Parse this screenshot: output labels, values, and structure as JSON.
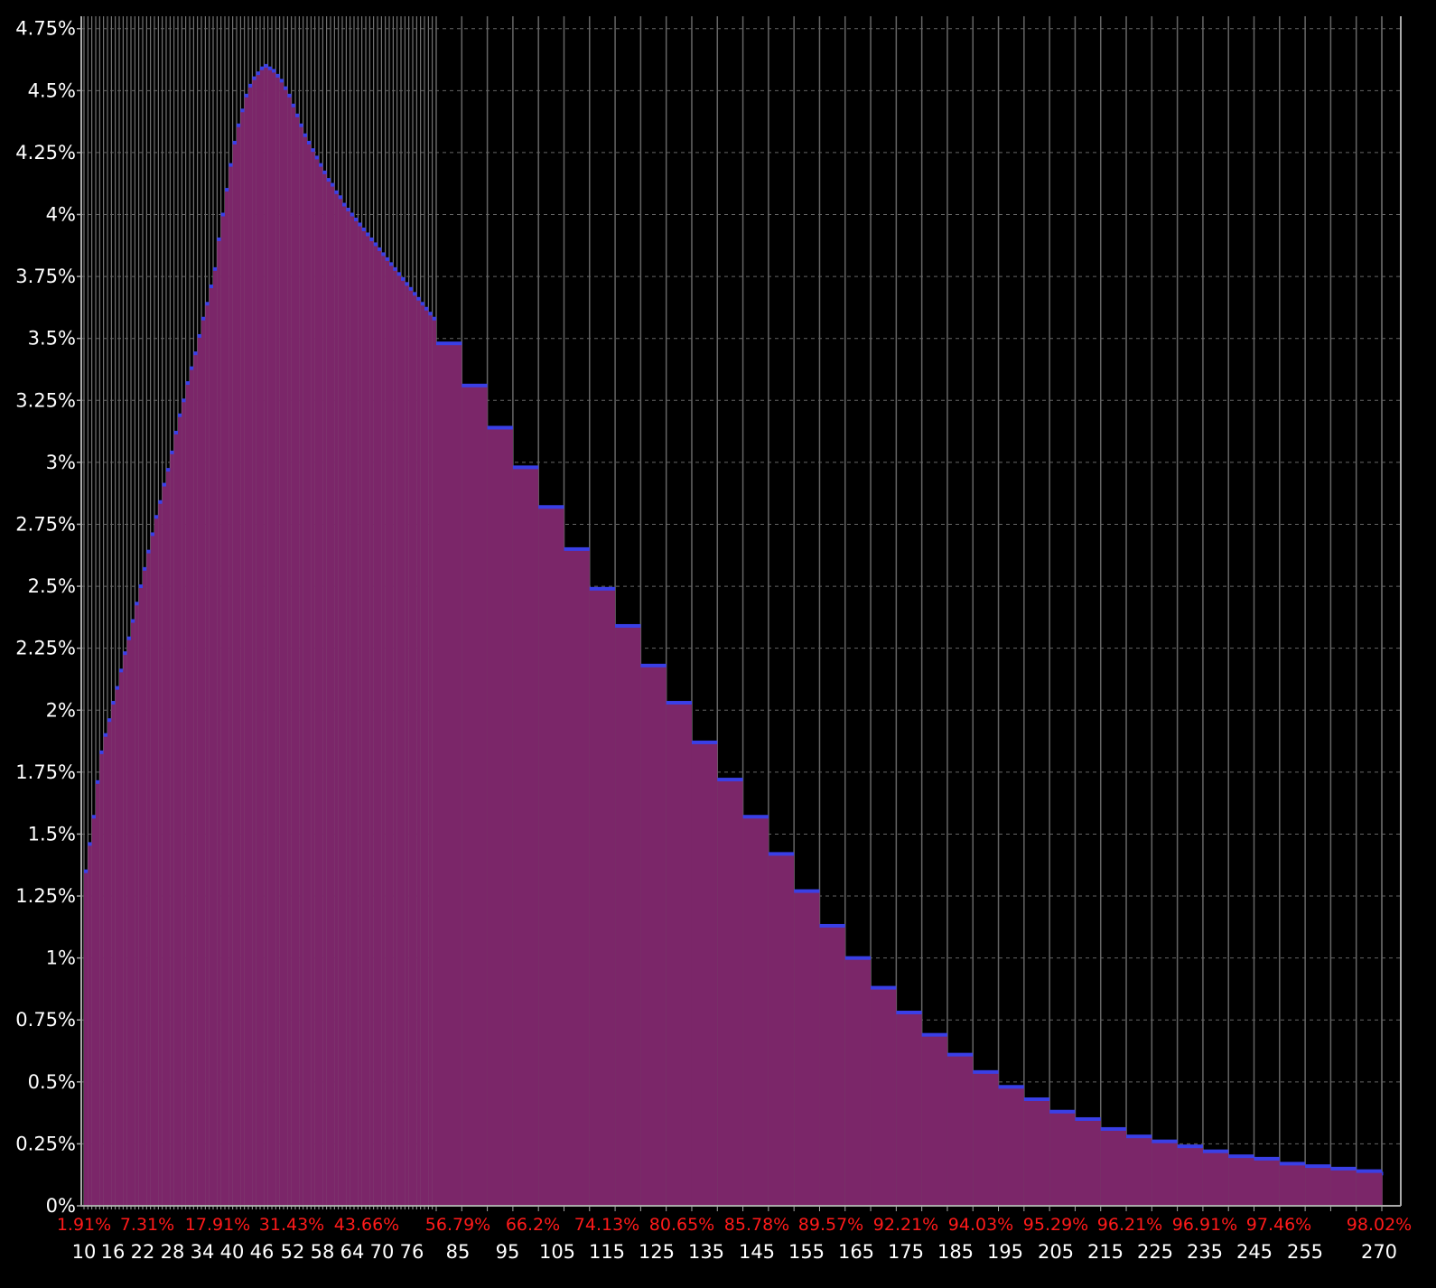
{
  "chart_data": {
    "type": "bar",
    "title": "",
    "xlabel": "",
    "ylabel": "",
    "ylim": [
      0,
      4.8
    ],
    "y_ticks": [
      "0%",
      "0.25%",
      "0.5%",
      "0.75%",
      "1%",
      "1.25%",
      "1.5%",
      "1.75%",
      "2%",
      "2.25%",
      "2.5%",
      "2.75%",
      "3%",
      "3.25%",
      "3.5%",
      "3.75%",
      "4%",
      "4.25%",
      "4.5%",
      "4.75%"
    ],
    "x_tick_labels": [
      {
        "x": 10,
        "label": "10"
      },
      {
        "x": 16,
        "label": "16"
      },
      {
        "x": 22,
        "label": "22"
      },
      {
        "x": 28,
        "label": "28"
      },
      {
        "x": 34,
        "label": "34"
      },
      {
        "x": 40,
        "label": "40"
      },
      {
        "x": 46,
        "label": "46"
      },
      {
        "x": 52,
        "label": "52"
      },
      {
        "x": 58,
        "label": "58"
      },
      {
        "x": 64,
        "label": "64"
      },
      {
        "x": 70,
        "label": "70"
      },
      {
        "x": 76,
        "label": "76"
      },
      {
        "x": 85,
        "label": "85"
      },
      {
        "x": 95,
        "label": "95"
      },
      {
        "x": 105,
        "label": "105"
      },
      {
        "x": 115,
        "label": "115"
      },
      {
        "x": 125,
        "label": "125"
      },
      {
        "x": 135,
        "label": "135"
      },
      {
        "x": 145,
        "label": "145"
      },
      {
        "x": 155,
        "label": "155"
      },
      {
        "x": 165,
        "label": "165"
      },
      {
        "x": 175,
        "label": "175"
      },
      {
        "x": 185,
        "label": "185"
      },
      {
        "x": 195,
        "label": "195"
      },
      {
        "x": 205,
        "label": "205"
      },
      {
        "x": 215,
        "label": "215"
      },
      {
        "x": 225,
        "label": "225"
      },
      {
        "x": 235,
        "label": "235"
      },
      {
        "x": 245,
        "label": "245"
      },
      {
        "x": 255,
        "label": "255"
      },
      {
        "x": 270,
        "label": "270"
      }
    ],
    "cumulative_labels": [
      {
        "x": 10,
        "label": "1.91%"
      },
      {
        "x": 22,
        "label": "7.31%"
      },
      {
        "x": 34,
        "label": "17.91%"
      },
      {
        "x": 46,
        "label": "31.43%"
      },
      {
        "x": 58,
        "label": "43.66%"
      },
      {
        "x": 85,
        "label": "56.79%"
      },
      {
        "x": 95,
        "label": "66.2%"
      },
      {
        "x": 105,
        "label": "74.13%"
      },
      {
        "x": 115,
        "label": "80.65%"
      },
      {
        "x": 125,
        "label": "85.78%"
      },
      {
        "x": 135,
        "label": "89.57%"
      },
      {
        "x": 145,
        "label": "92.21%"
      },
      {
        "x": 155,
        "label": "94.03%"
      },
      {
        "x": 165,
        "label": "95.29%"
      },
      {
        "x": 175,
        "label": "96.21%"
      },
      {
        "x": 185,
        "label": "96.91%"
      },
      {
        "x": 195,
        "label": "97.46%"
      },
      {
        "x": 270,
        "label": "98.02%"
      }
    ],
    "bars": [
      {
        "x": 10,
        "value": 1.35
      },
      {
        "x": 11,
        "value": 1.46
      },
      {
        "x": 12,
        "value": 1.57
      },
      {
        "x": 13,
        "value": 1.71
      },
      {
        "x": 14,
        "value": 1.83
      },
      {
        "x": 15,
        "value": 1.9
      },
      {
        "x": 16,
        "value": 1.96
      },
      {
        "x": 17,
        "value": 2.03
      },
      {
        "x": 18,
        "value": 2.09
      },
      {
        "x": 19,
        "value": 2.16
      },
      {
        "x": 20,
        "value": 2.23
      },
      {
        "x": 21,
        "value": 2.29
      },
      {
        "x": 22,
        "value": 2.36
      },
      {
        "x": 23,
        "value": 2.43
      },
      {
        "x": 24,
        "value": 2.5
      },
      {
        "x": 25,
        "value": 2.57
      },
      {
        "x": 26,
        "value": 2.64
      },
      {
        "x": 27,
        "value": 2.71
      },
      {
        "x": 28,
        "value": 2.78
      },
      {
        "x": 29,
        "value": 2.84
      },
      {
        "x": 30,
        "value": 2.91
      },
      {
        "x": 31,
        "value": 2.97
      },
      {
        "x": 32,
        "value": 3.04
      },
      {
        "x": 33,
        "value": 3.12
      },
      {
        "x": 34,
        "value": 3.19
      },
      {
        "x": 35,
        "value": 3.25
      },
      {
        "x": 36,
        "value": 3.32
      },
      {
        "x": 37,
        "value": 3.38
      },
      {
        "x": 38,
        "value": 3.44
      },
      {
        "x": 39,
        "value": 3.51
      },
      {
        "x": 40,
        "value": 3.58
      },
      {
        "x": 41,
        "value": 3.64
      },
      {
        "x": 42,
        "value": 3.71
      },
      {
        "x": 43,
        "value": 3.78
      },
      {
        "x": 44,
        "value": 3.9
      },
      {
        "x": 45,
        "value": 4.0
      },
      {
        "x": 46,
        "value": 4.1
      },
      {
        "x": 47,
        "value": 4.2
      },
      {
        "x": 48,
        "value": 4.29
      },
      {
        "x": 49,
        "value": 4.36
      },
      {
        "x": 50,
        "value": 4.42
      },
      {
        "x": 51,
        "value": 4.48
      },
      {
        "x": 52,
        "value": 4.52
      },
      {
        "x": 53,
        "value": 4.55
      },
      {
        "x": 54,
        "value": 4.57
      },
      {
        "x": 55,
        "value": 4.59
      },
      {
        "x": 56,
        "value": 4.6
      },
      {
        "x": 57,
        "value": 4.59
      },
      {
        "x": 58,
        "value": 4.58
      },
      {
        "x": 59,
        "value": 4.56
      },
      {
        "x": 60,
        "value": 4.54
      },
      {
        "x": 61,
        "value": 4.51
      },
      {
        "x": 62,
        "value": 4.48
      },
      {
        "x": 63,
        "value": 4.44
      },
      {
        "x": 64,
        "value": 4.4
      },
      {
        "x": 65,
        "value": 4.36
      },
      {
        "x": 66,
        "value": 4.32
      },
      {
        "x": 67,
        "value": 4.29
      },
      {
        "x": 68,
        "value": 4.26
      },
      {
        "x": 69,
        "value": 4.23
      },
      {
        "x": 70,
        "value": 4.2
      },
      {
        "x": 71,
        "value": 4.17
      },
      {
        "x": 72,
        "value": 4.14
      },
      {
        "x": 73,
        "value": 4.12
      },
      {
        "x": 74,
        "value": 4.09
      },
      {
        "x": 75,
        "value": 4.07
      },
      {
        "x": 76,
        "value": 4.04
      },
      {
        "x": 77,
        "value": 4.02
      },
      {
        "x": 78,
        "value": 4.0
      },
      {
        "x": 79,
        "value": 3.98
      },
      {
        "x": 80,
        "value": 3.96
      },
      {
        "x": 81,
        "value": 3.94
      },
      {
        "x": 82,
        "value": 3.92
      },
      {
        "x": 83,
        "value": 3.9
      },
      {
        "x": 84,
        "value": 3.88
      },
      {
        "x": 85,
        "value": 3.86
      },
      {
        "x": 86,
        "value": 3.84
      },
      {
        "x": 87,
        "value": 3.82
      },
      {
        "x": 88,
        "value": 3.8
      },
      {
        "x": 89,
        "value": 3.78
      },
      {
        "x": 90,
        "value": 3.76
      },
      {
        "x": 91,
        "value": 3.74
      },
      {
        "x": 92,
        "value": 3.72
      },
      {
        "x": 93,
        "value": 3.7
      },
      {
        "x": 94,
        "value": 3.68
      },
      {
        "x": 95,
        "value": 3.66
      },
      {
        "x": 96,
        "value": 3.64
      },
      {
        "x": 97,
        "value": 3.62
      },
      {
        "x": 98,
        "value": 3.6
      },
      {
        "x": 99,
        "value": 3.58
      },
      {
        "x": 100,
        "value": 3.48
      },
      {
        "x": 110,
        "value": 3.31
      },
      {
        "x": 120,
        "value": 3.14
      },
      {
        "x": 130,
        "value": 2.98
      },
      {
        "x": 140,
        "value": 2.82
      },
      {
        "x": 150,
        "value": 2.65
      },
      {
        "x": 160,
        "value": 2.49
      },
      {
        "x": 170,
        "value": 2.34
      },
      {
        "x": 180,
        "value": 2.18
      },
      {
        "x": 190,
        "value": 2.03
      },
      {
        "x": 200,
        "value": 1.87
      },
      {
        "x": 210,
        "value": 1.72
      },
      {
        "x": 220,
        "value": 1.57
      },
      {
        "x": 230,
        "value": 1.42
      },
      {
        "x": 240,
        "value": 1.27
      },
      {
        "x": 250,
        "value": 1.13
      },
      {
        "x": 260,
        "value": 1.0
      },
      {
        "x": 270,
        "value": 0.88
      },
      {
        "x": 280,
        "value": 0.78
      },
      {
        "x": 290,
        "value": 0.69
      },
      {
        "x": 300,
        "value": 0.61
      },
      {
        "x": 310,
        "value": 0.54
      },
      {
        "x": 320,
        "value": 0.48
      },
      {
        "x": 330,
        "value": 0.43
      },
      {
        "x": 340,
        "value": 0.38
      },
      {
        "x": 350,
        "value": 0.35
      },
      {
        "x": 360,
        "value": 0.31
      },
      {
        "x": 370,
        "value": 0.28
      },
      {
        "x": 380,
        "value": 0.26
      },
      {
        "x": 390,
        "value": 0.24
      },
      {
        "x": 400,
        "value": 0.22
      },
      {
        "x": 410,
        "value": 0.2
      },
      {
        "x": 420,
        "value": 0.19
      },
      {
        "x": 430,
        "value": 0.17
      },
      {
        "x": 440,
        "value": 0.16
      },
      {
        "x": 450,
        "value": 0.15
      },
      {
        "x": 460,
        "value": 0.14
      },
      {
        "x": 470,
        "value": 0.13
      }
    ],
    "grid": true,
    "colors": {
      "background": "#000000",
      "bar_fill": "#7b2669",
      "bar_top": "#3a3fe6",
      "grid": "#666666",
      "axis_text": "#ffffff",
      "cumulative_text": "#ff1a1a"
    }
  }
}
